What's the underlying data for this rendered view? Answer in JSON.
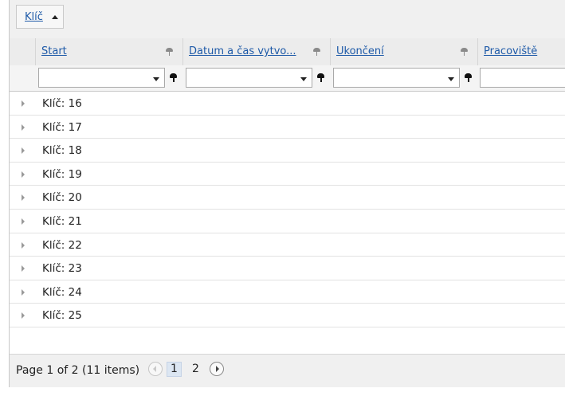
{
  "group_panel": {
    "group_label": "Klíč",
    "sort": "ascending"
  },
  "columns": [
    {
      "label": "Start"
    },
    {
      "label": "Datum a čas vytvo..."
    },
    {
      "label": "Ukončení"
    },
    {
      "label": "Pracoviště"
    }
  ],
  "filters": [
    {
      "value": ""
    },
    {
      "value": ""
    },
    {
      "value": ""
    },
    {
      "value": ""
    }
  ],
  "groups": [
    {
      "label": "Klíč: 16"
    },
    {
      "label": "Klíč: 17"
    },
    {
      "label": "Klíč: 18"
    },
    {
      "label": "Klíč: 19"
    },
    {
      "label": "Klíč: 20"
    },
    {
      "label": "Klíč: 21"
    },
    {
      "label": "Klíč: 22"
    },
    {
      "label": "Klíč: 23"
    },
    {
      "label": "Klíč: 24"
    },
    {
      "label": "Klíč: 25"
    }
  ],
  "pager": {
    "info": "Page 1 of 2 (11 items)",
    "current_page": "1",
    "next_page": "2"
  },
  "colors": {
    "link": "#1e5aa8",
    "header_bg": "#ececec",
    "current_page_bg": "#dce6f2"
  },
  "icons": [
    "sort-asc-icon",
    "pin-icon",
    "dropdown-caret-icon",
    "filter-icon",
    "expand-icon",
    "prev-page-icon",
    "next-page-icon"
  ]
}
